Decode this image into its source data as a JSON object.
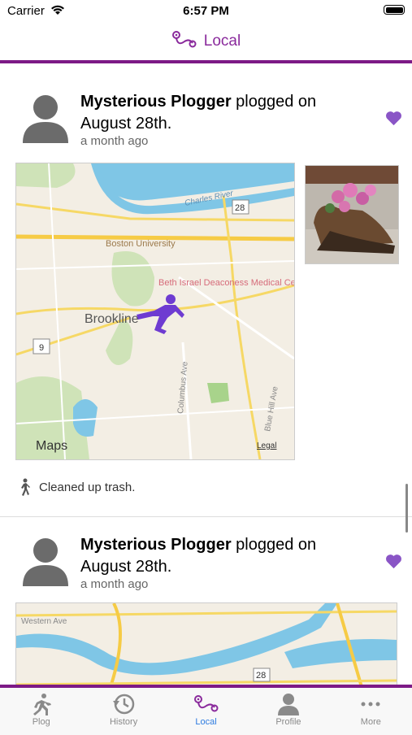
{
  "status_bar": {
    "carrier": "Carrier",
    "time": "6:57 PM"
  },
  "nav": {
    "title": "Local",
    "icon": "route-icon"
  },
  "posts": [
    {
      "user": "Mysterious Plogger",
      "action": "plogged on",
      "date": "August 28th.",
      "ago": "a month ago",
      "activity": "Cleaned up trash.",
      "map_labels": {
        "river": "Charles River",
        "univ": "Boston University",
        "hospital": "Beth Israel Deaconess Medical Center",
        "town": "Brookline",
        "street1": "Columbus Ave",
        "street2": "Blue Hill Ave",
        "route1": "28",
        "route2": "9",
        "maps_logo": "Maps",
        "legal": "Legal"
      }
    },
    {
      "user": "Mysterious Plogger",
      "action": "plogged on",
      "date": "August 28th.",
      "ago": "a month ago",
      "map_labels": {
        "street": "Western Ave",
        "route": "28"
      }
    }
  ],
  "tabs": [
    {
      "label": "Plog",
      "icon": "runner-icon"
    },
    {
      "label": "History",
      "icon": "history-icon"
    },
    {
      "label": "Local",
      "icon": "route-icon",
      "active": true
    },
    {
      "label": "Profile",
      "icon": "person-icon"
    },
    {
      "label": "More",
      "icon": "ellipsis-icon"
    }
  ],
  "colors": {
    "accent": "#7d1a86",
    "heart": "#8a55c6",
    "tab_active": "#2d7be0"
  }
}
